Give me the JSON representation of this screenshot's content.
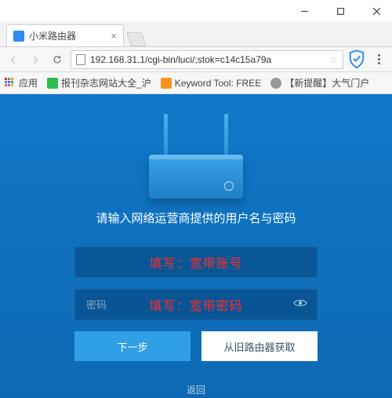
{
  "window": {
    "controls": {
      "min": "min",
      "max": "max",
      "close": "close"
    }
  },
  "tab": {
    "title": "小米路由器"
  },
  "address": {
    "url": "192.168.31.1/cgi-bin/luci/;stok=c14c15a79a"
  },
  "bookmarks": {
    "apps": "应用",
    "items": [
      {
        "label": "报刊杂志网站大全_沪"
      },
      {
        "label": "Keyword Tool: FREE"
      },
      {
        "label": "【新提醒】大气门户"
      }
    ]
  },
  "page": {
    "prompt": "请输入网络运营商提供的用户名与密码",
    "username": {
      "value": "",
      "placeholder": "",
      "annotation": "填写：宽带账号"
    },
    "password": {
      "value": "",
      "placeholder": "密码",
      "annotation": "填写：宽带密码"
    },
    "next_label": "下一步",
    "import_label": "从旧路由器获取",
    "back_label": "返回"
  }
}
